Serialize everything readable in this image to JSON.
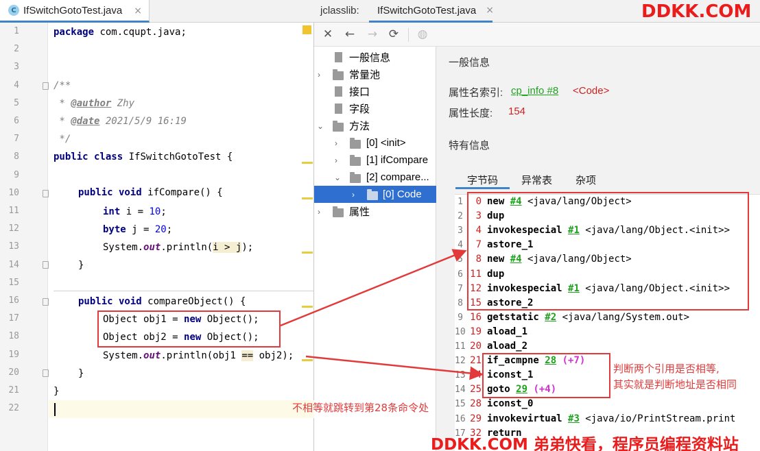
{
  "editor": {
    "tab_title": "IfSwitchGotoTest.java",
    "tab_icon_letter": "C",
    "close_glyph": "×",
    "line_numbers": [
      "1",
      "2",
      "3",
      "4",
      "5",
      "6",
      "7",
      "8",
      "9",
      "10",
      "11",
      "12",
      "13",
      "14",
      "15",
      "16",
      "17",
      "18",
      "19",
      "20",
      "21",
      "22"
    ],
    "lines": {
      "l1_kw": "package",
      "l1_rest": " com.cqupt.java;",
      "l4": "/**",
      "l5_pre": " * ",
      "l5_tag": "@author",
      "l5_val": " Zhy",
      "l6_pre": " * ",
      "l6_tag": "@date",
      "l6_val": " 2021/5/9 16:19",
      "l7": " */",
      "l8_kw": "public class",
      "l8_rest": " IfSwitchGotoTest {",
      "l10_kw": "public void",
      "l10_rest": " ifCompare() {",
      "l11_kw": "int",
      "l11_mid": " i = ",
      "l11_num": "10",
      "l11_end": ";",
      "l12_kw": "byte",
      "l12_mid": " j = ",
      "l12_num": "20",
      "l12_end": ";",
      "l13_a": "System.",
      "l13_f": "out",
      "l13_b": ".println(",
      "l13_hl": "i > j",
      "l13_c": ");",
      "l14": "}",
      "l16_kw": "public void",
      "l16_rest": " compareObject() {",
      "l17_a": "Object obj1 = ",
      "l17_kw": "new",
      "l17_b": " Object();",
      "l18_a": "Object obj2 = ",
      "l18_kw": "new",
      "l18_b": " Object();",
      "l19_a": "System.",
      "l19_f": "out",
      "l19_b": ".println(obj1 ",
      "l19_hl": "==",
      "l19_c": " obj2);",
      "l20": "}",
      "l21": "}"
    }
  },
  "jclasslib": {
    "tab_prefix": "jclasslib:",
    "tab_title": "IfSwitchGotoTest.java",
    "close_glyph": "×",
    "toolbar": {
      "close": "✕",
      "back": "←",
      "forward": "→",
      "refresh": "⟳",
      "web": "◍"
    },
    "tree": [
      {
        "label": "一般信息"
      },
      {
        "label": "常量池"
      },
      {
        "label": "接口"
      },
      {
        "label": "字段"
      },
      {
        "label": "方法"
      },
      {
        "label": "[0] <init>"
      },
      {
        "label": "[1] ifCompare"
      },
      {
        "label": "[2] compare..."
      },
      {
        "label": "[0] Code"
      },
      {
        "label": "属性"
      }
    ],
    "tree_arrows": {
      "collapsed": "›",
      "expanded": "⌄"
    },
    "general_heading": "一般信息",
    "attr_name_label": "属性名索引:",
    "attr_name_link": "cp_info #8",
    "attr_name_value": "<Code>",
    "attr_len_label": "属性长度:",
    "attr_len_value": "154",
    "specific_heading": "特有信息",
    "subtabs": [
      "字节码",
      "异常表",
      "杂项"
    ],
    "bytecode": [
      {
        "line": "1",
        "off": "0",
        "op": "new",
        "ref": "#4",
        "cmt": " <java/lang/Object>"
      },
      {
        "line": "2",
        "off": "3",
        "op": "dup"
      },
      {
        "line": "3",
        "off": "4",
        "op": "invokespecial",
        "ref": "#1",
        "cmt": " <java/lang/Object.<init>>"
      },
      {
        "line": "4",
        "off": "7",
        "op": "astore_1"
      },
      {
        "line": "5",
        "off": "8",
        "op": "new",
        "ref": "#4",
        "cmt": " <java/lang/Object>"
      },
      {
        "line": "6",
        "off": "11",
        "op": "dup"
      },
      {
        "line": "7",
        "off": "12",
        "op": "invokespecial",
        "ref": "#1",
        "cmt": " <java/lang/Object.<init>>"
      },
      {
        "line": "8",
        "off": "15",
        "op": "astore_2"
      },
      {
        "line": "9",
        "off": "16",
        "op": "getstatic",
        "ref": "#2",
        "cmt": " <java/lang/System.out>"
      },
      {
        "line": "10",
        "off": "19",
        "op": "aload_1"
      },
      {
        "line": "11",
        "off": "20",
        "op": "aload_2"
      },
      {
        "line": "12",
        "off": "21",
        "op": "if_acmpne",
        "ref": "28",
        "jump": " (+7)"
      },
      {
        "line": "13",
        "off": "24",
        "op": "iconst_1"
      },
      {
        "line": "14",
        "off": "25",
        "op": "goto",
        "ref": "29",
        "jump": " (+4)"
      },
      {
        "line": "15",
        "off": "28",
        "op": "iconst_0"
      },
      {
        "line": "16",
        "off": "29",
        "op": "invokevirtual",
        "ref": "#3",
        "cmt": " <java/io/PrintStream.print"
      },
      {
        "line": "17",
        "off": "32",
        "op": "return"
      }
    ]
  },
  "annotations": {
    "jump_note": "不相等就跳转到第28条命令处",
    "compare_note_1": "判断两个引用是否相等,",
    "compare_note_2": "其实就是判断地址是否相同"
  },
  "watermarks": {
    "top": "DDKK.COM",
    "bottom": "DDKK.COM 弟弟快看，程序员编程资料站"
  },
  "colors": {
    "accent_blue": "#4083c9",
    "selection_blue": "#2f6fd0",
    "annotation_red": "#e23a3a",
    "link_green": "#1ea21e",
    "jump_magenta": "#d12fd1"
  }
}
